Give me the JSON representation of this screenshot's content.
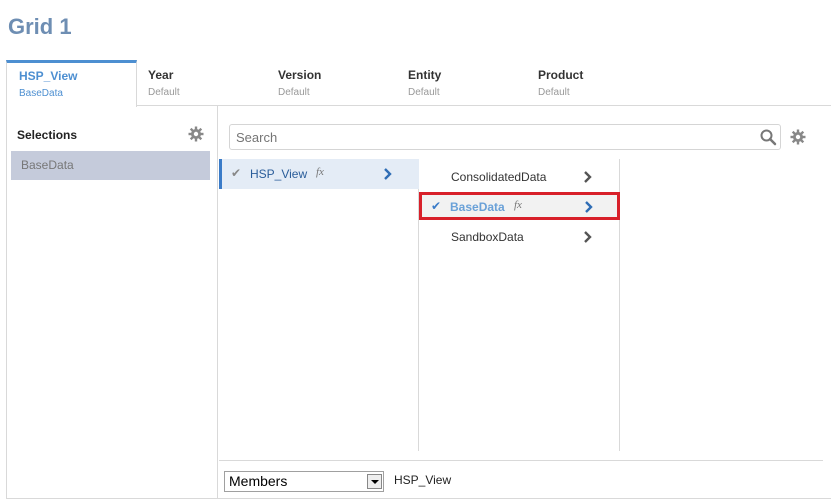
{
  "page": {
    "title": "Grid 1"
  },
  "tabs": [
    {
      "name": "HSP_View",
      "value": "BaseData"
    },
    {
      "name": "Year",
      "value": "Default"
    },
    {
      "name": "Version",
      "value": "Default"
    },
    {
      "name": "Entity",
      "value": "Default"
    },
    {
      "name": "Product",
      "value": "Default"
    }
  ],
  "selections": {
    "title": "Selections",
    "items": [
      "BaseData"
    ]
  },
  "search": {
    "placeholder": "Search"
  },
  "columns": {
    "level1": [
      {
        "label": "HSP_View",
        "formula": "fx"
      }
    ],
    "level2": [
      {
        "label": "ConsolidatedData"
      },
      {
        "label": "BaseData",
        "formula": "fx"
      },
      {
        "label": "SandboxData"
      }
    ]
  },
  "footer": {
    "select_value": "Members",
    "context": "HSP_View"
  }
}
